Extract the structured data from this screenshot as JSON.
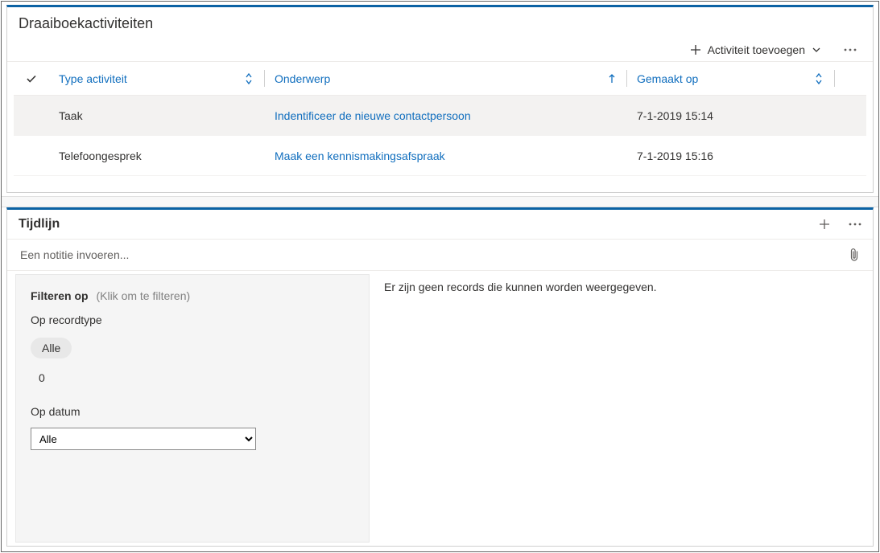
{
  "activities": {
    "title": "Draaiboekactiviteiten",
    "add_label": "Activiteit toevoegen",
    "columns": {
      "type": "Type activiteit",
      "subject": "Onderwerp",
      "created": "Gemaakt op"
    },
    "rows": [
      {
        "type": "Taak",
        "subject": "Indentificeer de nieuwe contactpersoon",
        "created": "7-1-2019 15:14"
      },
      {
        "type": "Telefoongesprek",
        "subject": "Maak een kennismakingsafspraak",
        "created": "7-1-2019 15:16"
      }
    ]
  },
  "timeline": {
    "title": "Tijdlijn",
    "note_placeholder": "Een notitie invoeren...",
    "empty": "Er zijn geen records die kunnen worden weergegeven.",
    "filter": {
      "title": "Filteren op",
      "hint": "(Klik om te filteren)",
      "record_type_label": "Op recordtype",
      "chip_all": "Alle",
      "count": "0",
      "date_label": "Op datum",
      "date_value": "Alle"
    }
  }
}
